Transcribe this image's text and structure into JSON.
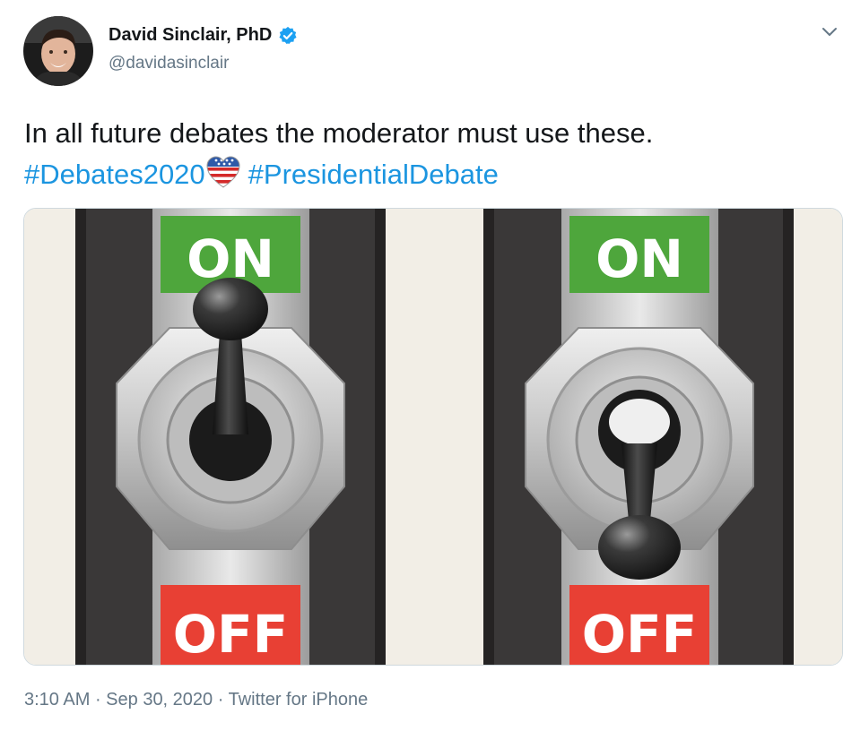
{
  "author": {
    "name": "David Sinclair, PhD",
    "handle": "@davidasinclair",
    "verified": true,
    "avatar_icon": "profile-photo-icon"
  },
  "tweet": {
    "text": "In all future debates the moderator must use these.",
    "hashtags": [
      "#Debates2020",
      "#PresidentialDebate"
    ],
    "emoji_icon": "american-flag-heart-icon"
  },
  "media": {
    "switches": [
      {
        "on_label": "ON",
        "off_label": "OFF",
        "position": "on"
      },
      {
        "on_label": "ON",
        "off_label": "OFF",
        "position": "off"
      }
    ],
    "colors": {
      "on": "#4ea63c",
      "off": "#e84034",
      "rail": "#3a3838",
      "metal": "#c9c9c9"
    }
  },
  "footer": {
    "time": "3:10 AM",
    "date": "Sep 30, 2020",
    "source": "Twitter for iPhone"
  },
  "colors": {
    "link": "#1b95e0",
    "text": "#14171a",
    "muted": "#657786",
    "verified": "#1da1f2"
  }
}
